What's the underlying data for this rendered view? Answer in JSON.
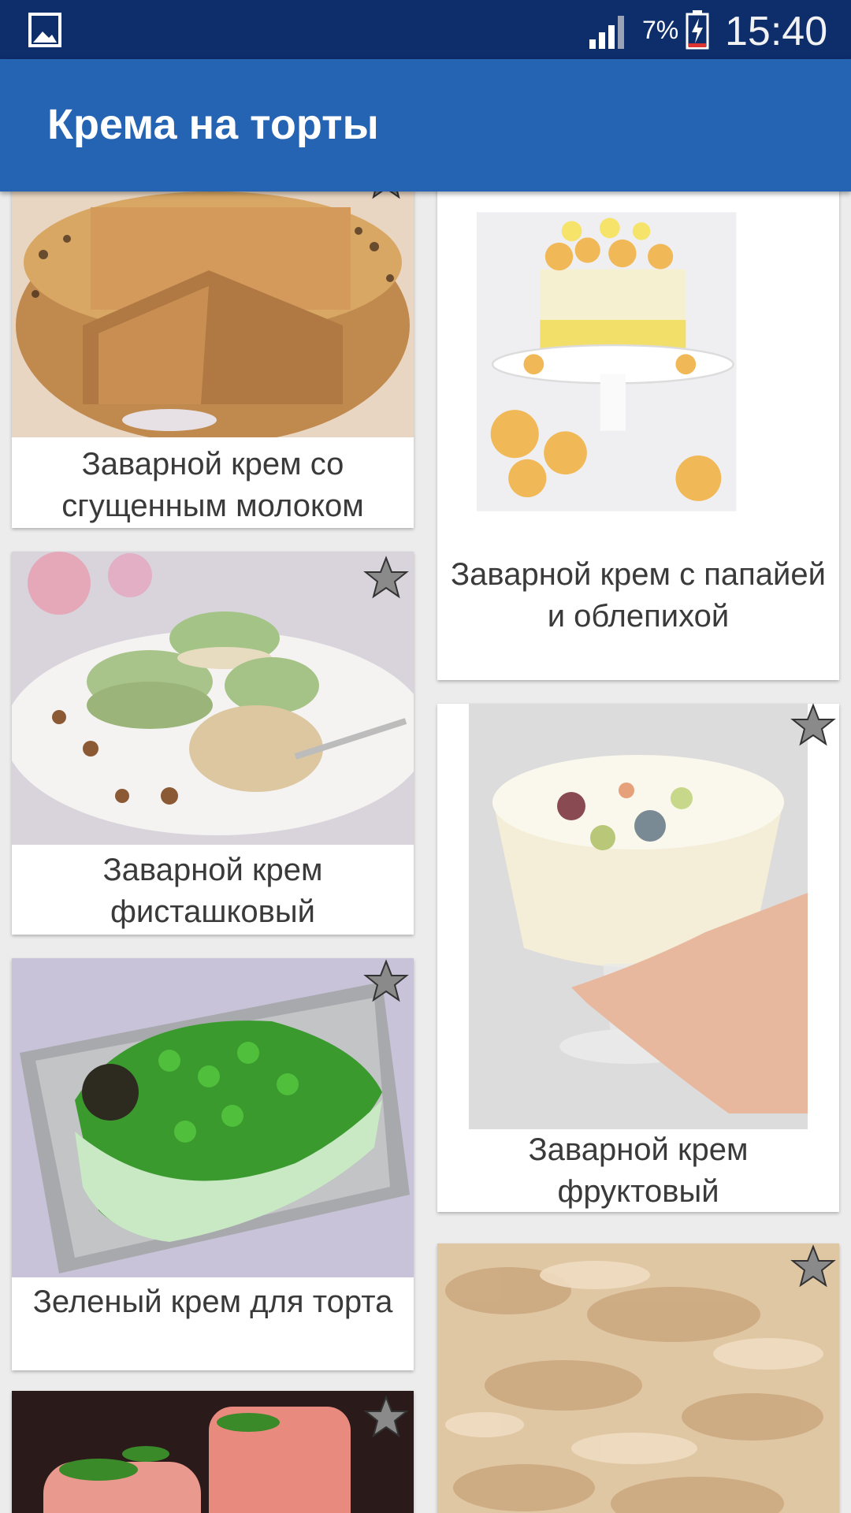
{
  "status_bar": {
    "battery": "7%",
    "time": "15:40",
    "icons": [
      "gallery-icon",
      "signal-icon",
      "battery-charging-icon"
    ]
  },
  "app_bar": {
    "title": "Крема на торты"
  },
  "recipes": [
    {
      "title": "Заварной крем со сгущенным молоком",
      "image": "layered-cake-with-nuts"
    },
    {
      "title": "Заварной крем с папайей и облепихой",
      "image": "yellow-cake-with-meringues"
    },
    {
      "title": "Заварной крем фисташковый",
      "image": "pistachio-macarons"
    },
    {
      "title": "Заварной крем фруктовый",
      "image": "fruit-cream-glass"
    },
    {
      "title": "Зеленый крем для торта",
      "image": "green-cream-cake"
    },
    {
      "title": "",
      "image": "caramel-cream"
    },
    {
      "title": "",
      "image": "strawberry-dessert-glasses"
    }
  ],
  "colors": {
    "status_bar": "#0d2d6b",
    "app_bar": "#2563b3",
    "background": "#ececec",
    "star": "#8a8a8a"
  }
}
